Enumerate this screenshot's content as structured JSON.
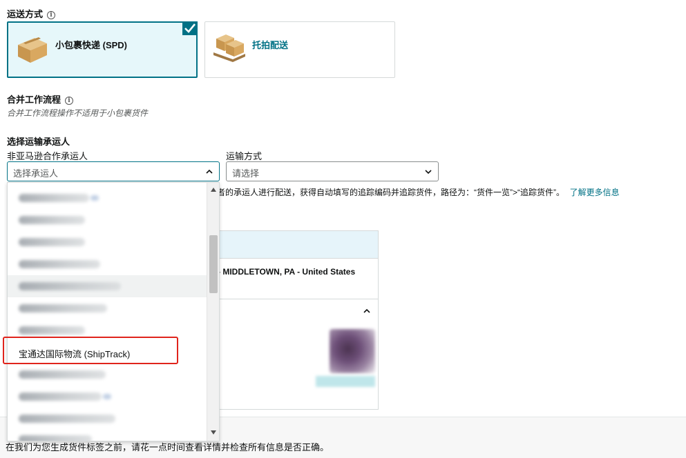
{
  "shipping_method": {
    "title": "运送方式",
    "options": [
      {
        "label": "小包裹快递 (SPD)",
        "selected": true,
        "icon": "cardboard-box-icon"
      },
      {
        "label": "托拍配送",
        "selected": false,
        "icon": "pallet-boxes-icon"
      }
    ]
  },
  "workflow": {
    "title": "合并工作流程",
    "note": "合并工作流程操作不适用于小包裹货件"
  },
  "carrier": {
    "title": "选择运输承运人",
    "carrier_label": "非亚马逊合作承运人",
    "carrier_placeholder": "选择承运人",
    "method_label": "运输方式",
    "method_placeholder": "请选择",
    "hint_fragment": "者的承运人进行配送，获得自动填写的追踪编码并追踪货件，路径为：“货件一览”>“追踪货件”。",
    "learn_more": "了解更多信息"
  },
  "address_panel": {
    "city_line": "- MIDDLETOWN, PA - United States"
  },
  "dropdown": {
    "highlighted_item": "宝通达国际物流 (ShipTrack)"
  },
  "footer": {
    "text": "在我们为您生成货件标签之前，请花一点时间查看详情并检查所有信息是否正确。"
  },
  "colors": {
    "accent": "#007185",
    "selected_bg": "#e6f7fa",
    "highlight_border": "#e0231b"
  }
}
